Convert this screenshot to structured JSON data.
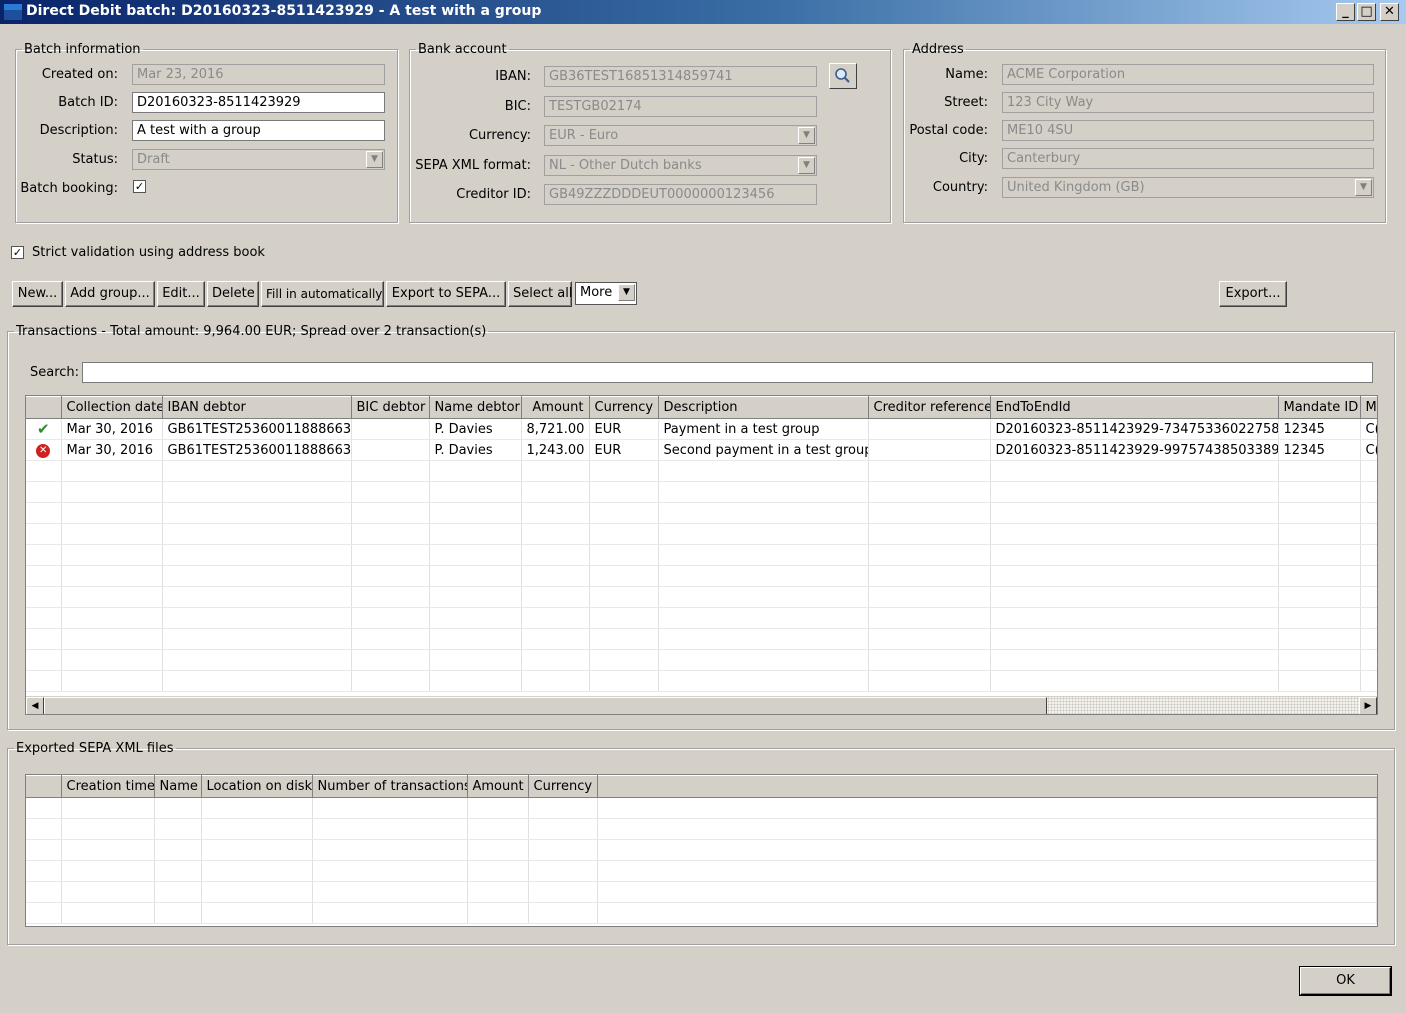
{
  "window": {
    "title": "Direct Debit batch: D20160323-8511423929 - A test with a group",
    "minimize": "_",
    "maximize": "□",
    "close": "✕"
  },
  "batch_info": {
    "legend": "Batch information",
    "created_label": "Created on:",
    "created_value": "Mar 23, 2016",
    "batch_id_label": "Batch ID:",
    "batch_id_value": "D20160323-8511423929",
    "description_label": "Description:",
    "description_value": "A test with a group",
    "status_label": "Status:",
    "status_value": "Draft",
    "batch_booking_label": "Batch booking:",
    "batch_booking_checked": true
  },
  "bank_account": {
    "legend": "Bank account",
    "iban_label": "IBAN:",
    "iban_value": "GB36TEST16851314859741",
    "bic_label": "BIC:",
    "bic_value": "TESTGB02174",
    "currency_label": "Currency:",
    "currency_value": "EUR - Euro",
    "sepa_label": "SEPA XML format:",
    "sepa_value": "NL - Other Dutch banks",
    "creditor_label": "Creditor ID:",
    "creditor_value": "GB49ZZZDDDEUT0000000123456",
    "lookup_icon": "search-icon"
  },
  "address": {
    "legend": "Address",
    "name_label": "Name:",
    "name_value": "ACME Corporation",
    "street_label": "Street:",
    "street_value": "123 City Way",
    "postal_label": "Postal code:",
    "postal_value": "ME10 4SU",
    "city_label": "City:",
    "city_value": "Canterbury",
    "country_label": "Country:",
    "country_value": "United Kingdom (GB)"
  },
  "strict_validation": {
    "label": "Strict validation using address book",
    "checked": true
  },
  "toolbar": {
    "new": "New...",
    "add_group": "Add group...",
    "edit": "Edit...",
    "delete": "Delete",
    "fill": "Fill in automatically",
    "export_sepa": "Export to SEPA...",
    "select_all": "Select all",
    "more": "More",
    "export": "Export..."
  },
  "transactions": {
    "legend": "Transactions - Total amount: 9,964.00 EUR; Spread over 2 transaction(s)",
    "search_label": "Search:",
    "search_value": "",
    "columns": [
      "",
      "Collection date",
      "IBAN debtor",
      "BIC debtor",
      "Name debtor",
      "Amount",
      "Currency",
      "Description",
      "Creditor reference",
      "EndToEndId",
      "Mandate ID",
      "M"
    ],
    "rows": [
      {
        "status": "ok",
        "status_icon": "check-icon",
        "date": "Mar 30, 2016",
        "iban": "GB61TEST25360011888663",
        "bic": "",
        "name": "P. Davies",
        "amount": "8,721.00",
        "currency": "EUR",
        "description": "Payment in a test group",
        "creditor_ref": "",
        "e2e": "D20160323-8511423929-73475336022758",
        "mandate": "12345",
        "m": "C("
      },
      {
        "status": "error",
        "status_icon": "error-icon",
        "date": "Mar 30, 2016",
        "iban": "GB61TEST25360011888663",
        "bic": "",
        "name": "P. Davies",
        "amount": "1,243.00",
        "currency": "EUR",
        "description": "Second payment in a test group",
        "creditor_ref": "",
        "e2e": "D20160323-8511423929-99757438503389",
        "mandate": "12345",
        "m": "C("
      }
    ]
  },
  "exported": {
    "legend": "Exported SEPA XML files",
    "columns": [
      "",
      "Creation time",
      "Name",
      "Location on disk",
      "Number of transactions",
      "Amount",
      "Currency"
    ]
  },
  "ok_button": "OK",
  "colors": {
    "window_bg": "#d4d0c8",
    "title_start": "#0a246a",
    "ok_status": "#2e8b2e",
    "error_status": "#d02020"
  }
}
